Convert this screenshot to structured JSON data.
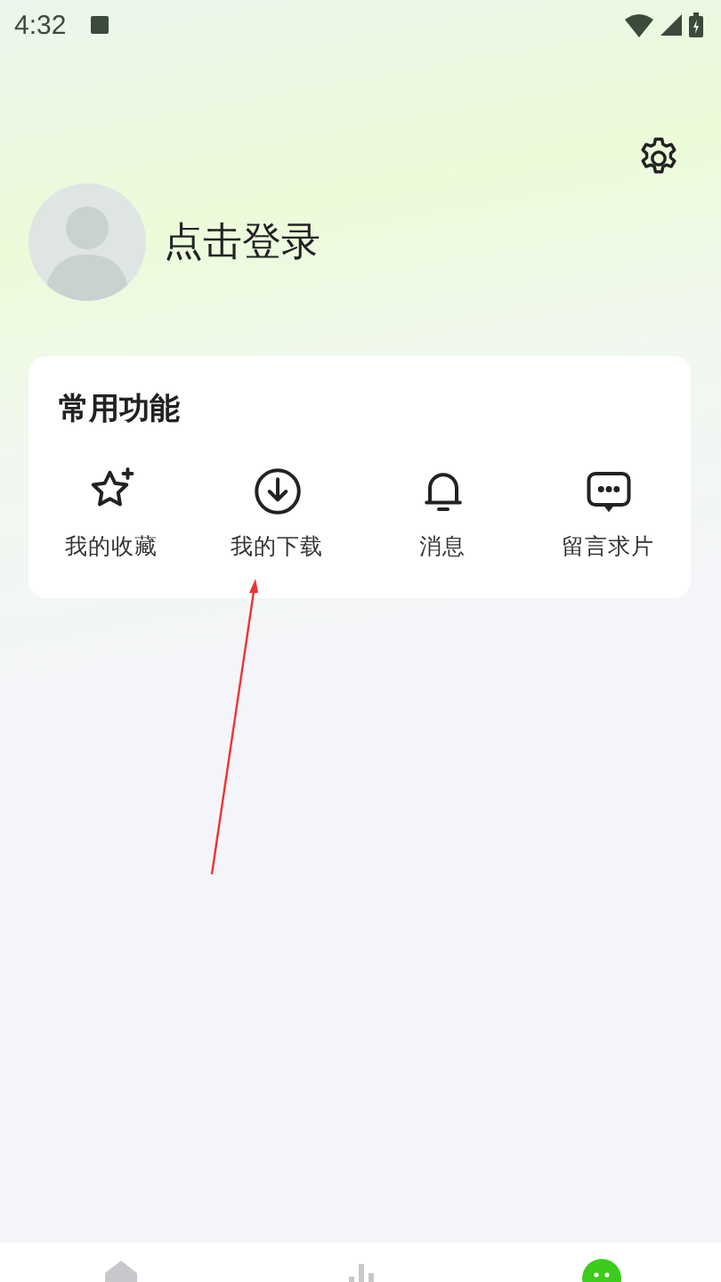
{
  "status_bar": {
    "time": "4:32"
  },
  "profile": {
    "login_text": "点击登录"
  },
  "common_functions": {
    "title": "常用功能",
    "items": [
      {
        "kind": "star",
        "label": "我的收藏"
      },
      {
        "kind": "download",
        "label": "我的下载"
      },
      {
        "kind": "bell",
        "label": "消息"
      },
      {
        "kind": "message",
        "label": "留言求片"
      }
    ]
  },
  "bottom_nav": [
    {
      "kind": "home",
      "selected": false
    },
    {
      "kind": "chart",
      "selected": false
    },
    {
      "kind": "face",
      "selected": true
    }
  ]
}
